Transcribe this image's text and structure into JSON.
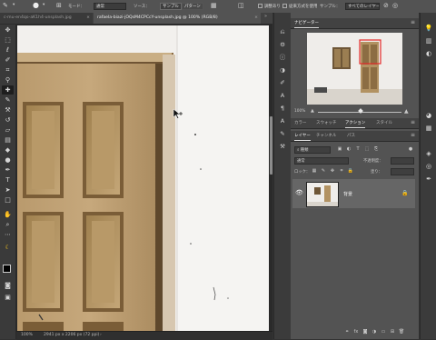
{
  "options_bar": {
    "mode_label": "モード：",
    "mode_value": "通常",
    "source_label": "ソース：",
    "sample_button": "サンプル",
    "pattern_button": "パターン",
    "align_label": "調整あり",
    "legacy_label": "従来方式を使用",
    "sample_label": "サンプル：",
    "sample_value": "すべてのレイヤー"
  },
  "tabs": [
    {
      "label": "c-mu-en4qo-aK1h4-unsplash.jpg",
      "active": false
    },
    {
      "label": "rafaela-biazi-jOQsM4CPCcY-unsplash.jpg @ 100% (RGB/8)",
      "active": true
    }
  ],
  "status": {
    "zoom": "100%",
    "info": "2941 px x 2206 px (72 ppi)"
  },
  "navigator": {
    "title": "ナビゲーター",
    "zoom": "100%"
  },
  "actions_tabs": [
    "カラー",
    "スウォッチ",
    "アクション",
    "スタイル"
  ],
  "actions_active": 2,
  "layers_tabs": [
    "レイヤー",
    "チャンネル",
    "パス"
  ],
  "layers_active": 0,
  "layers": {
    "kind_label": "種類",
    "blend_mode": "通常",
    "opacity_label": "不透明度：",
    "lock_label": "ロック：",
    "fill_label": "塗り：",
    "rows": [
      {
        "name": "背景",
        "visible": true,
        "locked": true
      }
    ]
  },
  "icons": {
    "tools": [
      "move-icon",
      "marquee-icon",
      "lasso-icon",
      "quick-select-icon",
      "crop-icon",
      "eyedropper-icon",
      "healing-brush-icon",
      "brush-icon",
      "clone-stamp-icon",
      "history-brush-icon",
      "eraser-icon",
      "gradient-icon",
      "blur-icon",
      "dodge-icon",
      "pen-icon",
      "type-icon",
      "path-select-icon",
      "rectangle-icon",
      "hand-icon",
      "zoom-icon",
      "edit-toolbar-icon",
      "banana-icon",
      "color-swatches-icon",
      "quick-mask-icon",
      "screen-mode-icon"
    ],
    "accent": "#2d8ceb"
  }
}
